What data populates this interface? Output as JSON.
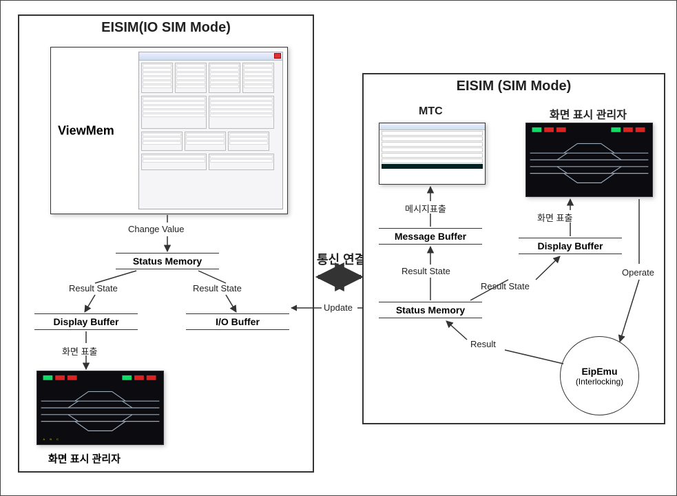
{
  "left": {
    "title": "EISIM(IO SIM Mode)",
    "viewmem_label": "ViewMem",
    "change_value": "Change Value",
    "status_memory": "Status Memory",
    "result_state_l": "Result State",
    "result_state_r": "Result State",
    "display_buffer": "Display Buffer",
    "io_buffer": "I/O Buffer",
    "screen_output": "화면 표출",
    "track_caption": "화면 표시 관리자"
  },
  "center": {
    "comm_link": "통신 연결",
    "update": "Update"
  },
  "right": {
    "title": "EISIM (SIM Mode)",
    "mtc_label": "MTC",
    "display_manager": "화면 표시 관리자",
    "msg_out": "메시지표출",
    "message_buffer": "Message Buffer",
    "display_buffer": "Display Buffer",
    "screen_output": "화면 표출",
    "result_state_1": "Result State",
    "result_state_2": "Result State",
    "status_memory": "Status Memory",
    "result": "Result",
    "operate": "Operate",
    "eipemu_name": "EipEmu",
    "eipemu_sub": "(Interlocking)"
  }
}
